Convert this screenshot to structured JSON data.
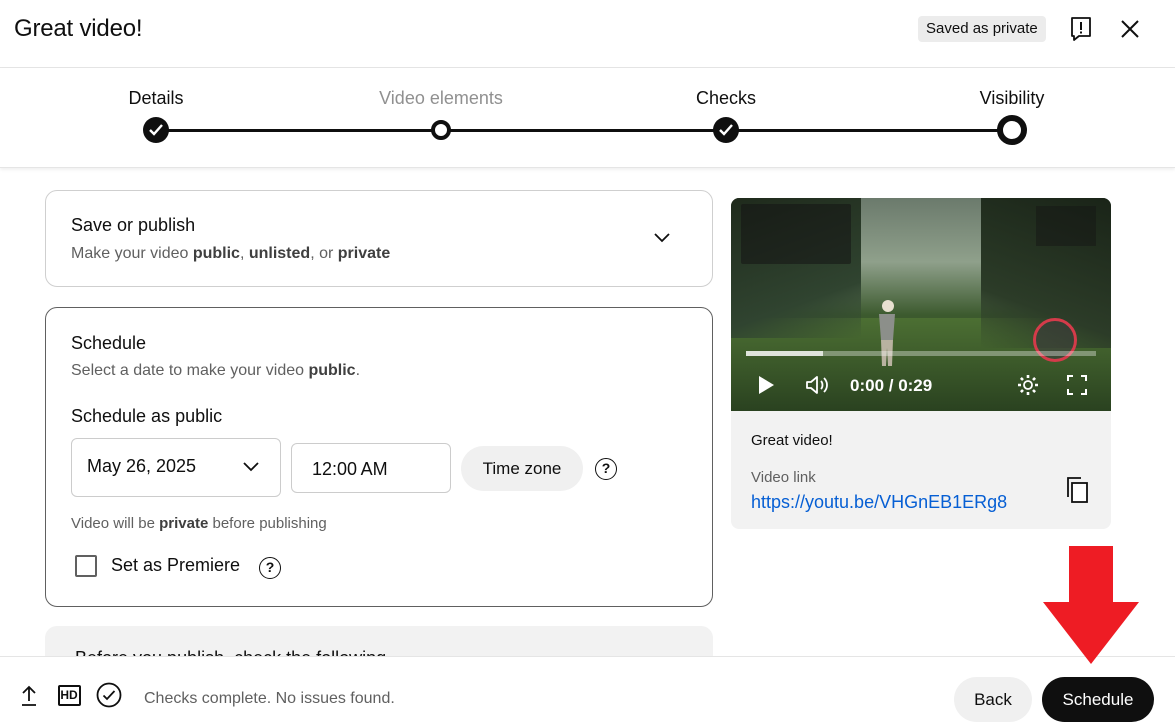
{
  "header": {
    "title": "Great video!",
    "saved_badge": "Saved as private"
  },
  "steps": [
    {
      "label": "Details",
      "state": "done"
    },
    {
      "label": "Video elements",
      "state": "open"
    },
    {
      "label": "Checks",
      "state": "done"
    },
    {
      "label": "Visibility",
      "state": "current"
    }
  ],
  "save_card": {
    "title": "Save or publish",
    "subtitle_prefix": "Make your video ",
    "opt_public": "public",
    "sep1": ", ",
    "opt_unlisted": "unlisted",
    "sep2": ", or ",
    "opt_private": "private"
  },
  "schedule_card": {
    "title": "Schedule",
    "subtitle_prefix": "Select a date to make your video ",
    "subtitle_bold": "public",
    "subtitle_suffix": ".",
    "schedule_as": "Schedule as public",
    "date_value": "May 26, 2025",
    "time_value": "12:00 AM",
    "timezone_label": "Time zone",
    "private_note_prefix": "Video will be ",
    "private_note_bold": "private",
    "private_note_suffix": " before publishing",
    "premiere_label": "Set as Premiere",
    "premiere_checked": false
  },
  "before_card": {
    "title": "Before you publish, check the following"
  },
  "preview": {
    "video_time": "0:00 / 0:29",
    "progress": 0.22,
    "title": "Great video!",
    "link_label": "Video link",
    "link_url": "https://youtu.be/VHGnEB1ERg8"
  },
  "footer": {
    "status": "Checks complete. No issues found.",
    "hd_label": "HD",
    "back_label": "Back",
    "schedule_label": "Schedule"
  },
  "colors": {
    "link": "#065fd4",
    "annotation_arrow": "#ee1c24",
    "primary_button": "#0f0f0f"
  }
}
